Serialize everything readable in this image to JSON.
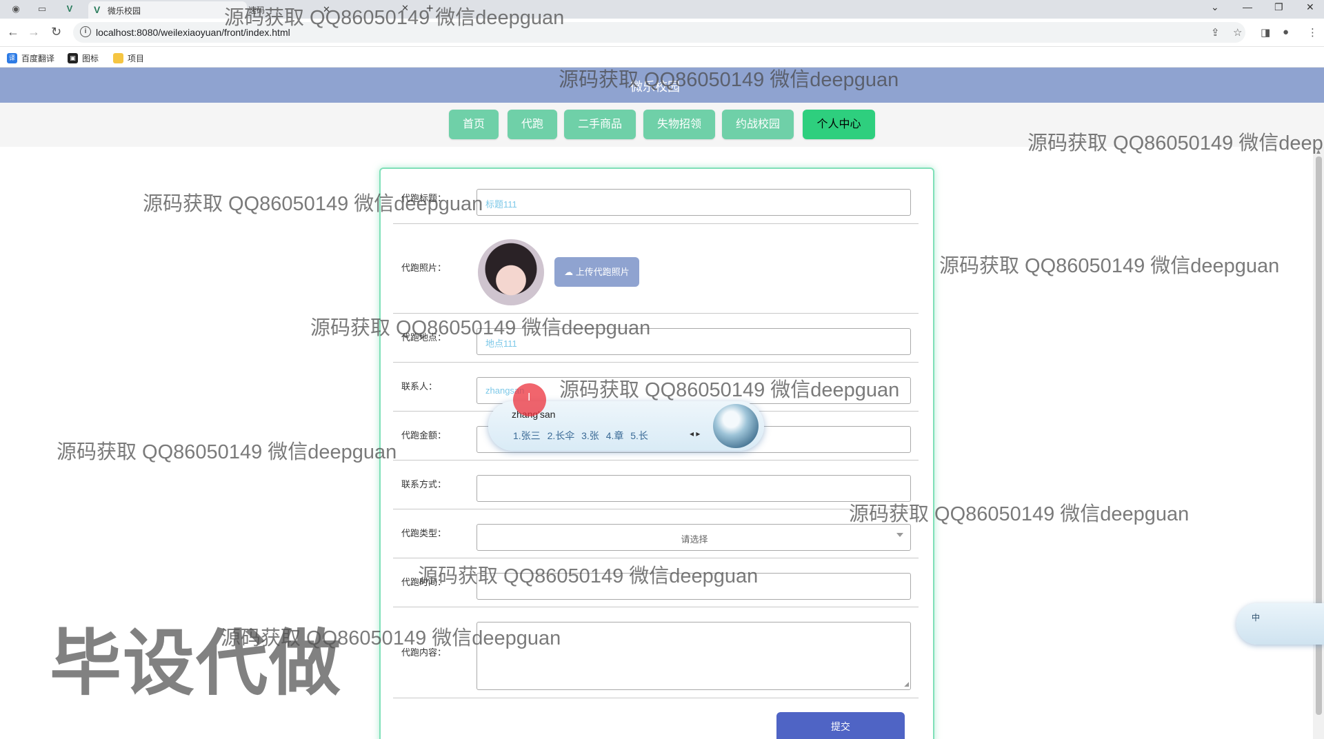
{
  "browser": {
    "tab_title": "微乐校园",
    "tab2_title": "速码",
    "url": "localhost:8080/weilexiaoyuan/front/index.html",
    "bookmarks": [
      "百度翻译",
      "图标",
      "项目"
    ]
  },
  "site": {
    "title": "微乐校园",
    "nav": [
      "首页",
      "代跑",
      "二手商品",
      "失物招领",
      "约战校园",
      "个人中心"
    ],
    "active_nav": "个人中心"
  },
  "form": {
    "title_label": "代跑标题：",
    "title_value": "标题111",
    "photo_label": "代跑照片：",
    "upload_label": "上传代跑照片",
    "location_label": "代跑地点：",
    "location_value": "地点111",
    "contact_label": "联系人：",
    "contact_value": "zhangsan",
    "amount_label": "代跑金额：",
    "phone_label": "联系方式：",
    "type_label": "代跑类型：",
    "type_placeholder": "请选择",
    "time_label": "代跑时间：",
    "content_label": "代跑内容：",
    "submit_label": "提交"
  },
  "ime": {
    "composition": "zhang'san",
    "candidates": "1.张三  2.长伞  3.张  4.章  5.长",
    "status": "中"
  },
  "overlay": {
    "watermark_text": "源码获取 QQ86050149 微信deepguan",
    "big_text": "毕设代做"
  },
  "colors": {
    "header": "#8fa3d0",
    "nav_button": "#6fd0a8",
    "nav_active": "#2ecf7e",
    "submit": "#4f64c5",
    "form_border": "#7fe0b8"
  }
}
